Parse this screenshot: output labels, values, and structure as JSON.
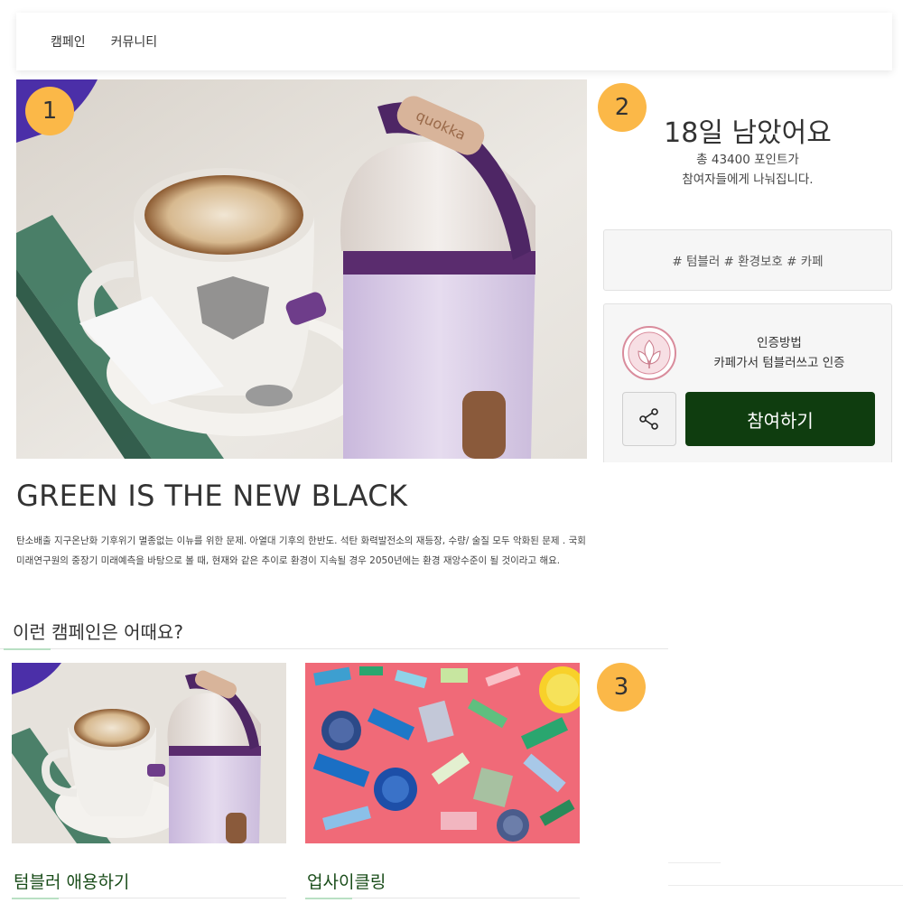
{
  "nav": {
    "items": [
      {
        "label": "캠페인"
      },
      {
        "label": "커뮤니티"
      }
    ]
  },
  "badges": {
    "one": "1",
    "two": "2",
    "three": "3"
  },
  "hero": {
    "bottle_brand": "quokka",
    "image": "cup-and-tumbler-photo"
  },
  "campaign": {
    "days_left": "18일 남았어요",
    "points_line1": "총 43400 포인트가",
    "points_line2": "참여자들에게 나눠집니다.",
    "tags": "# 텀블러 # 환경보호 # 카페",
    "cert_title": "인증방법",
    "cert_desc": "카페가서 텀블러쓰고 인증",
    "share_icon": "share-icon",
    "join_label": "참여하기",
    "title": "GREEN IS THE NEW BLACK",
    "description": "탄소배출 지구온난화 기후위기 멸종없는 이뉴를 위한 문제. 아열대 기후의 한반도. 석탄 화력발전소의 재등장, 수량/ 술질 모두 악화된 문제 . 국회 미래연구원의 중장기 미래예측을 바탕으로 볼 때, 현재와 같은 추이로 환경이 지속될 경우 2050년에는 환경 재앙수준이 될 것이라고 해요."
  },
  "recommend": {
    "heading": "이런 캠페인은 어때요?",
    "cards": [
      {
        "title": "텀블러 애용하기",
        "image": "tumbler-photo"
      },
      {
        "title": "업사이클링",
        "image": "plastic-pieces-photo"
      }
    ]
  },
  "colors": {
    "badge": "#fbb848",
    "join_button": "#0f3d0f",
    "card_title": "#1a4d1a",
    "accent_line": "#b9e0c4"
  }
}
